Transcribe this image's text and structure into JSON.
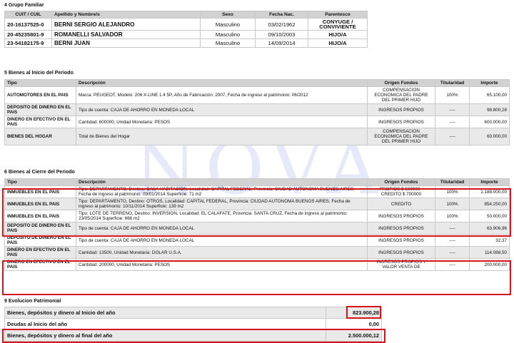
{
  "grupo_familiar": {
    "title": "4 Grupo Familiar",
    "headers": [
      "CUIT / CUIL",
      "Apellido y Nombre/s",
      "Sexo",
      "Fecha Nac.",
      "Parentesco"
    ],
    "rows": [
      [
        "20-16137525-0",
        "BERNI SERGIO ALEJANDRO",
        "Masculino",
        "03/02/1962",
        "CONYUGE / CONVIVIENTE"
      ],
      [
        "20-45235801-9",
        "ROMANELLI SALVADOR",
        "Masculino",
        "09/10/2003",
        "HIJO/A"
      ],
      [
        "23-54182175-9",
        "BERNI JUAN",
        "Masculino",
        "14/09/2014",
        "HIJO/A"
      ]
    ]
  },
  "bienes_inicio": {
    "title": "5 Bienes al Inicio del Periodo",
    "headers": [
      "Tipo",
      "Descripción",
      "Origen Fondos",
      "Titularidad",
      "Importe"
    ],
    "rows": [
      [
        "AUTOMOTORES EN EL PAIS",
        "Marca: PEUGEOT, Modelo: 206 X-LINE 1.4 5P, Año de Fabricación: 2007, Fecha de ingreso al patrimonio: 06/2012",
        "COMPENSACION ECONOMICA DEL PADRE DEL PRIMER HIJO",
        "100%",
        "65.100,00"
      ],
      [
        "DEPOSITO DE DINERO EN EL PAIS",
        "Tipo de cuenta: CAJA DE AHORRO EN MONEDA LOCAL",
        "INGRESOS PROPIOS",
        "----",
        "98.800,28"
      ],
      [
        "DINERO EN EFECTIVO EN EL PAIS",
        "Cantidad: 600000, Unidad Monetaria: PESOS",
        "INGRESOS PROPIOS",
        "----",
        "600.000,00"
      ],
      [
        "BIENES DEL HOGAR",
        "Total de Bienes del Hogar",
        "COMPENSACION ECONOMICA DEL PADRE DEL PRIMER HIJO",
        "----",
        "60.000,00"
      ]
    ]
  },
  "bienes_cierre": {
    "title": "6 Bienes al Cierre del Periodo",
    "headers": [
      "Tipo",
      "Descripción",
      "Origen Fondos",
      "Titularidad",
      "Importe"
    ],
    "rows": [
      [
        "INMUEBLES EN EL PAIS",
        "Tipo: DEPARTAMENTO, Destino: CASA HABITACION, Localidad: CAPITAL FEDERAL, Provincia: CIUDAD AUTONOMA BUENOS AIRES, Fecha de ingreso al patrimonio: 09/01/2014 Superficie: 71 m2",
        "PROPIOS $ 500000 - CREDITO $ 700000",
        "100%",
        "1.188.000,00"
      ],
      [
        "INMUEBLES EN EL PAIS",
        "Tipo: DEPARTAMENTO, Destino: OTROS, Localidad: CAPITAL FEDERAL, Provincia: CIUDAD AUTONOMA BUENOS AIRES, Fecha de ingreso al patrimonio: 10/11/2014 Superficie: 139 m2",
        "CREDITO",
        "100%",
        "854.250,00"
      ],
      [
        "INMUEBLES EN EL PAIS",
        "Tipo: LOTE DE TERRENO, Destino: INVERSION, Localidad: EL CALAFATE, Provincia: SANTA CRUZ, Fecha de ingreso al patrimonio: 23/05/2014 Superficie: 666 m2",
        "INGRESOS PROPIOS",
        "100%",
        "50.000,00"
      ],
      [
        "DEPOSITO DE DINERO EN EL PAIS",
        "Tipo de cuenta: CAJA DE AHORRO EN MONEDA LOCAL",
        "INGRESOS PROPIOS",
        "----",
        "63.906,96"
      ],
      [
        "DEPOSITO DE DINERO EN EL PAIS",
        "Tipo de cuenta: CAJA DE AHORRO EN MONEDA LOCAL",
        "INGRESOS PROPIOS",
        "----",
        "32,37"
      ],
      [
        "DINERO EN EFECTIVO EN EL PAIS",
        "Cantidad: 13500, Unidad Monetaria: DOLAR U.S.A.",
        "INGRESOS PROPIOS",
        "----",
        "114.088,50"
      ],
      [
        "DINERO EN EFECTIVO EN EL PAIS",
        "Cantidad: 200000, Unidad Monetaria: PESOS",
        "INGRESOS PROPIOS Y VALOR VENTA DE",
        "----",
        "200.000,00"
      ]
    ]
  },
  "evolucion": {
    "title": "9 Evolucion Patrimonial",
    "rows": [
      [
        "Bienes, depósitos y dinero al Inicio del año",
        "823.900,28"
      ],
      [
        "Deudas al Inicio del año",
        "0,00"
      ],
      [
        "Bienes, depósitos y dinero al final del año",
        "2.500.000,12"
      ]
    ]
  },
  "watermark": "NOVA"
}
